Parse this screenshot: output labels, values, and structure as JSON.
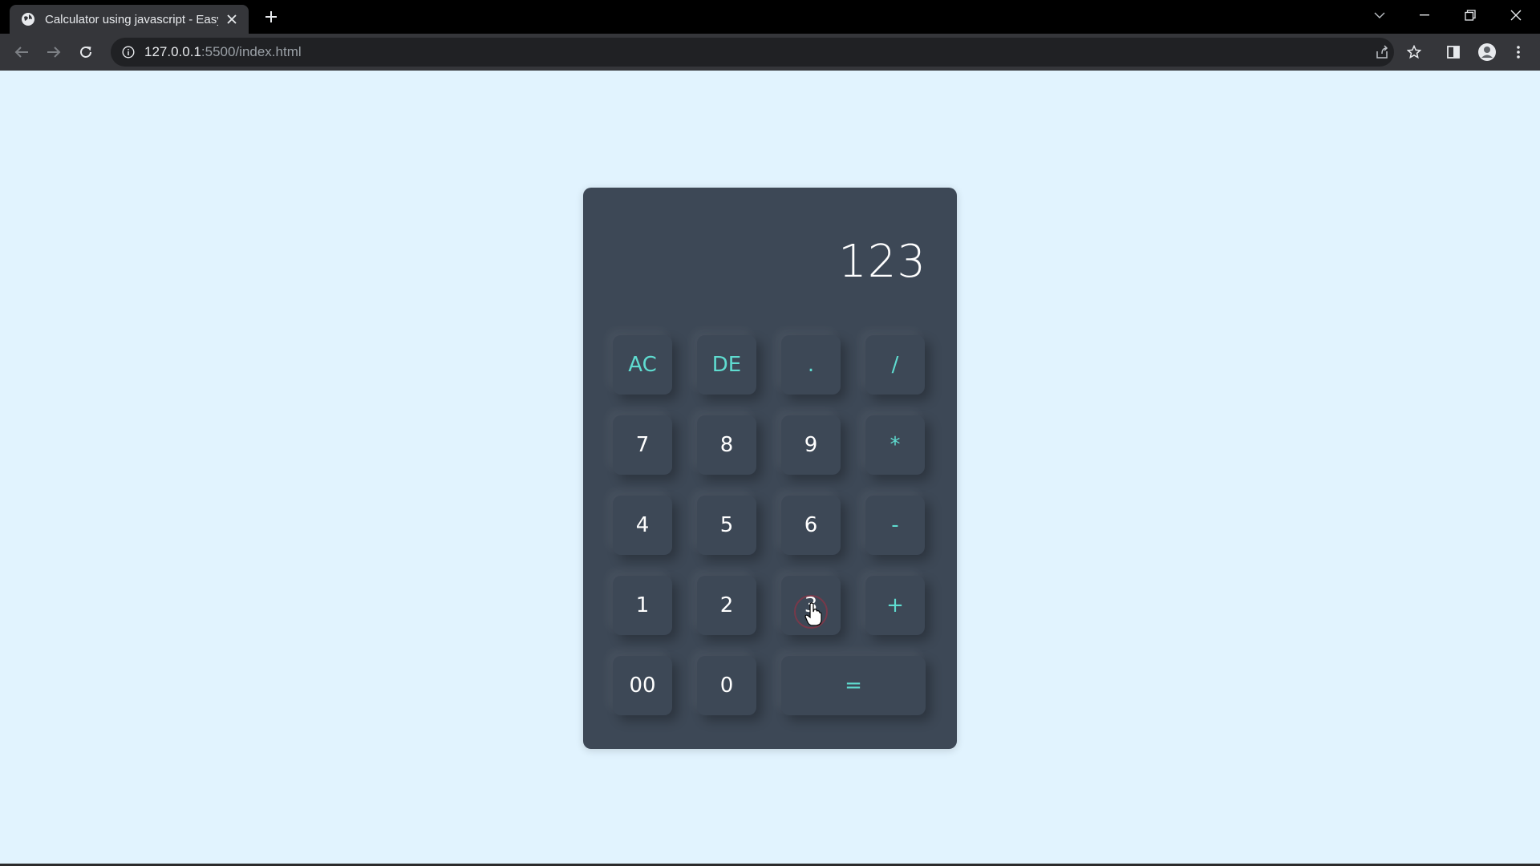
{
  "browser": {
    "tab_title": "Calculator using javascript - Easy",
    "url_host": "127.0.0.1",
    "url_rest": ":5500/index.html"
  },
  "calculator": {
    "display_value": "123",
    "rows": [
      [
        {
          "label": "AC",
          "kind": "op"
        },
        {
          "label": "DE",
          "kind": "op"
        },
        {
          "label": ".",
          "kind": "op"
        },
        {
          "label": "/",
          "kind": "op"
        }
      ],
      [
        {
          "label": "7",
          "kind": "num"
        },
        {
          "label": "8",
          "kind": "num"
        },
        {
          "label": "9",
          "kind": "num"
        },
        {
          "label": "*",
          "kind": "op"
        }
      ],
      [
        {
          "label": "4",
          "kind": "num"
        },
        {
          "label": "5",
          "kind": "num"
        },
        {
          "label": "6",
          "kind": "num"
        },
        {
          "label": "-",
          "kind": "op"
        }
      ],
      [
        {
          "label": "1",
          "kind": "num"
        },
        {
          "label": "2",
          "kind": "num"
        },
        {
          "label": "3",
          "kind": "num"
        },
        {
          "label": "+",
          "kind": "op"
        }
      ],
      [
        {
          "label": "00",
          "kind": "num"
        },
        {
          "label": "0",
          "kind": "num"
        },
        {
          "label": "=",
          "kind": "op"
        }
      ]
    ]
  },
  "colors": {
    "page_background": "#e1f3fe",
    "calculator_body": "#3d4856",
    "operator_text": "#5fdcd0",
    "number_text": "#ffffff"
  }
}
